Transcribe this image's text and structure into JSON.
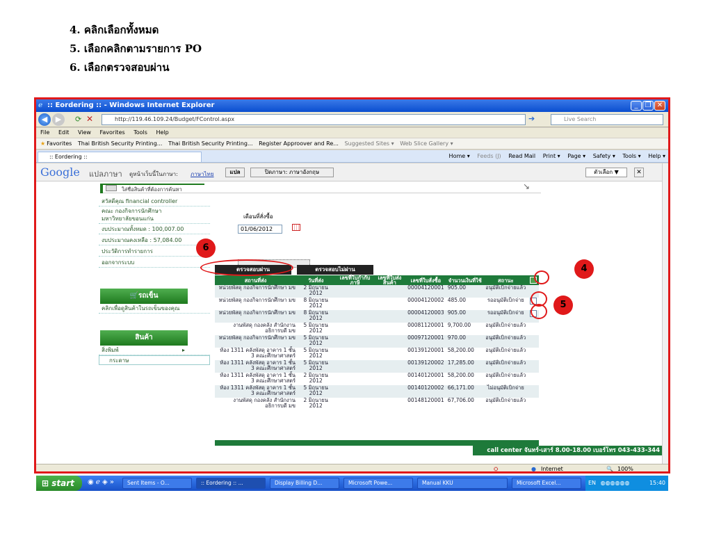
{
  "instructions": [
    "4.  คลิกเลือกทั้งหมด",
    "5.  เลือกคลิกตามรายการ PO",
    "6.  เลือกตรวจสอบผ่าน"
  ],
  "window": {
    "title": ":: Eordering :: - Windows Internet Explorer"
  },
  "browser": {
    "url": "http://119.46.109.24/Budget/FControl.aspx",
    "search_placeholder": "Live Search",
    "menu": [
      "File",
      "Edit",
      "View",
      "Favorites",
      "Tools",
      "Help"
    ],
    "favorites_label": "Favorites",
    "favorites": [
      "Thai British Security Printing...",
      "Thai British Security Printing...",
      "Register Approover and Re...",
      "Suggested Sites ▾",
      "Web Slice Gallery ▾"
    ],
    "tab_label": ":: Eordering ::",
    "commands": [
      "Home ▾",
      "Feeds (J)",
      "Read Mail",
      "Print ▾",
      "Page ▾",
      "Safety ▾",
      "Tools ▾",
      "Help ▾"
    ],
    "status_zone": "Internet",
    "zoom": "100%"
  },
  "google_bar": {
    "logo": "Google",
    "translate_label": "แปลภาษา",
    "view_in": "ดูหน้าเว็บนี้ในภาษา:",
    "language": "ภาษาไทย",
    "translate_button": "แปล",
    "turn_off": "ปิดภาษา: ภาษาอังกฤษ",
    "options": "ตัวเลือก ▼"
  },
  "page": {
    "search_placeholder": "ใส่ชื่อสินค้าที่ต้องการค้นหา",
    "sidebar_info": [
      "สวัสดีคุณ financial controller",
      "คณะ กองกิจการนักศึกษา",
      "มหาวิทยาลัยขอนแก่น",
      "งบประมาณทั้งหมด : 100,007.00",
      "งบประมาณคงเหลือ : 57,084.00",
      "ประวัติการทำรายการ",
      "ออกจากระบบ"
    ],
    "cart_heading": "รถเข็น",
    "cart_link": "คลิกเพื่อดูสินค้าในรถเข็นของคุณ",
    "product_heading": "สินค้า",
    "product_items": [
      "สิ่งพิมพ์",
      "กระดาษ"
    ],
    "order_month_label": "เดือนที่สั่งซื้อ",
    "order_date": "01/06/2012",
    "btn_pass": "ตรวจสอบผ่าน",
    "btn_fail": "ตรวจสอบไม่ผ่าน",
    "columns": [
      "สถานที่ส่ง",
      "วันที่ส่ง",
      "เลขที่ใบกำกับภาษี",
      "เลขที่ใบส่งสินค้า",
      "เลขที่ใบสั่งซื้อ",
      "จำนวนเงินที่ใช้",
      "สถานะ"
    ],
    "rows": [
      {
        "place": "หน่วยพัสดุ กองกิจการนักศึกษา มข",
        "date": "2 มิถุนายน 2012",
        "po": "00004120001",
        "amount": "905.00",
        "status": "อนุมัติเบิกจ่ายแล้ว"
      },
      {
        "place": "หน่วยพัสดุ กองกิจการนักศึกษา มข",
        "date": "8 มิถุนายน 2012",
        "po": "00004120002",
        "amount": "485.00",
        "status": "รออนุมัติเบิกจ่าย"
      },
      {
        "place": "หน่วยพัสดุ กองกิจการนักศึกษา มข",
        "date": "8 มิถุนายน 2012",
        "po": "00004120003",
        "amount": "905.00",
        "status": "รออนุมัติเบิกจ่าย"
      },
      {
        "place": "งานพัสดุ กองคลัง สำนักงานอธิการบดี มข",
        "date": "5 มิถุนายน 2012",
        "po": "00081120001",
        "amount": "9,700.00",
        "status": "อนุมัติเบิกจ่ายแล้ว"
      },
      {
        "place": "หน่วยพัสดุ กองกิจการนักศึกษา มข",
        "date": "5 มิถุนายน 2012",
        "po": "00097120001",
        "amount": "970.00",
        "status": "อนุมัติเบิกจ่ายแล้ว"
      },
      {
        "place": "ห้อง 1311 คลังพัสดุ อาคาร 1 ชั้น 3 คณะศึกษาศาสตร์",
        "date": "5 มิถุนายน 2012",
        "po": "00139120001",
        "amount": "58,200.00",
        "status": "อนุมัติเบิกจ่ายแล้ว"
      },
      {
        "place": "ห้อง 1311 คลังพัสดุ อาคาร 1 ชั้น 3 คณะศึกษาศาสตร์",
        "date": "5 มิถุนายน 2012",
        "po": "00139120002",
        "amount": "17,285.00",
        "status": "อนุมัติเบิกจ่ายแล้ว"
      },
      {
        "place": "ห้อง 1311 คลังพัสดุ อาคาร 1 ชั้น 3 คณะศึกษาศาสตร์",
        "date": "2 มิถุนายน 2012",
        "po": "00140120001",
        "amount": "58,200.00",
        "status": "อนุมัติเบิกจ่ายแล้ว"
      },
      {
        "place": "ห้อง 1311 คลังพัสดุ อาคาร 1 ชั้น 3 คณะศึกษาศาสตร์",
        "date": "5 มิถุนายน 2012",
        "po": "00140120002",
        "amount": "66,171.00",
        "status": "ไม่อนุมัติเบิกจ่าย"
      },
      {
        "place": "งานพัสดุ กองคลัง สำนักงานอธิการบดี มข",
        "date": "2 มิถุนายน 2012",
        "po": "00148120001",
        "amount": "67,706.00",
        "status": "อนุมัติเบิกจ่ายแล้ว"
      }
    ],
    "footer": "call center จันทร์-เสาร์ 8.00-18.00 เบอร์โทร 043-433-344"
  },
  "callouts": [
    "4",
    "5",
    "6"
  ],
  "taskbar": {
    "start": "start",
    "items": [
      "Sent Items - O...",
      ":: Eordering :: ...",
      "Display Billing D...",
      "Microsoft Powe...",
      "Manual KKU",
      "Microsoft Excel..."
    ],
    "lang": "EN",
    "clock": "15:40"
  }
}
